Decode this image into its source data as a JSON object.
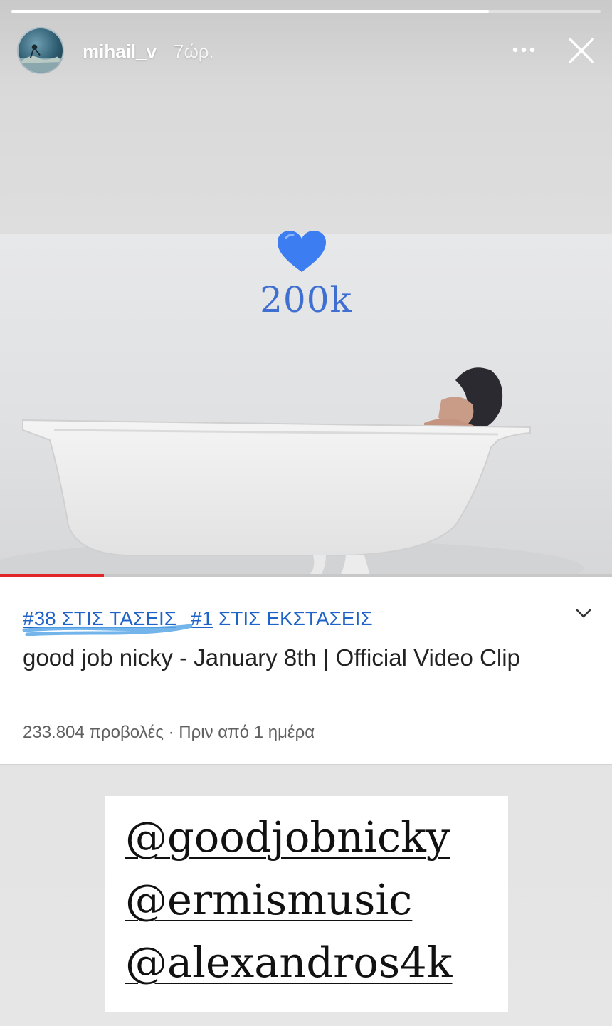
{
  "story": {
    "username": "mihail_v",
    "time": "7ώρ.",
    "progress": 0.81,
    "icons": [
      "avatar",
      "more-options-icon",
      "close-icon"
    ]
  },
  "video": {
    "sticker_icon": "blue-heart-icon",
    "sticker_text": "200k",
    "playback_progress": 0.17,
    "accent_color": "#3f6fd1"
  },
  "card": {
    "trending_tag": "#38 ΣΤΙΣ ΤΑΣΕΙΣ",
    "trending_tag_number": "#38",
    "trending_tag_rest": " ΣΤΙΣ ΤΑΣΕΙΣ",
    "music_tag_number": "#1",
    "music_tag_rest": " ΣΤΙΣ ΕΚΣΤΑΣΕΙΣ",
    "title": "good job nicky - January 8th | Official Video Clip",
    "meta": "233.804 προβολές · Πριν από 1 ημέρα",
    "link_color": "#1f63c9"
  },
  "mentions": [
    "@goodjobnicky",
    "@ermismusic",
    "@alexandros4k"
  ]
}
